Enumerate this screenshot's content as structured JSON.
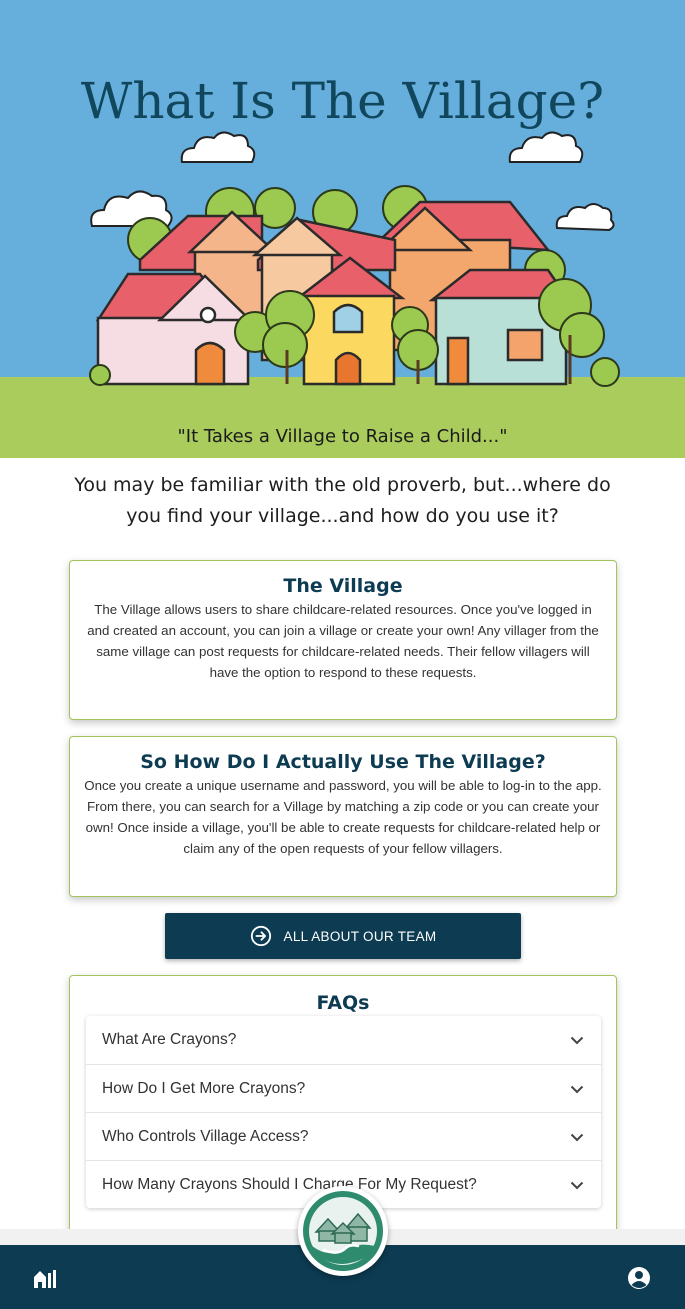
{
  "hero": {
    "title": "What Is The Village?",
    "proverb": "\"It Takes a Village to Raise a Child...\""
  },
  "intro": "You may be familiar with the old proverb, but...where do you find your village...and how do you use it?",
  "cards": [
    {
      "title": "The Village",
      "body": "The Village allows users to share childcare-related resources. Once you've logged in and created an account, you can join a village or create your own! Any villager from the same village can post requests for childcare-related needs. Their fellow villagers will have the option to respond to these requests."
    },
    {
      "title": "So How Do I Actually Use The Village?",
      "body": "Once you create a unique username and password, you will be able to log-in to the app. From there, you can search for a Village by matching a zip code or you can create your own! Once inside a village, you'll be able to create requests for childcare-related help or claim any of the open requests of your fellow villagers."
    }
  ],
  "team_button": {
    "label": "ALL ABOUT OUR TEAM",
    "icon": "arrow-circle-right-icon"
  },
  "faq": {
    "title": "FAQs",
    "items": [
      "What Are Crayons?",
      "How Do I Get More Crayons?",
      "Who Controls Village Access?",
      "How Many Crayons Should I Charge For My Request?"
    ]
  },
  "nav": {
    "home_icon": "village-home-icon",
    "user_icon": "account-circle-icon",
    "logo_icon": "village-logo-icon"
  },
  "colors": {
    "navy": "#0d3b52",
    "sky": "#66aedb",
    "grass": "#a9cc5d",
    "card_border": "#a3c45a",
    "logo_green": "#2e8b6e"
  }
}
